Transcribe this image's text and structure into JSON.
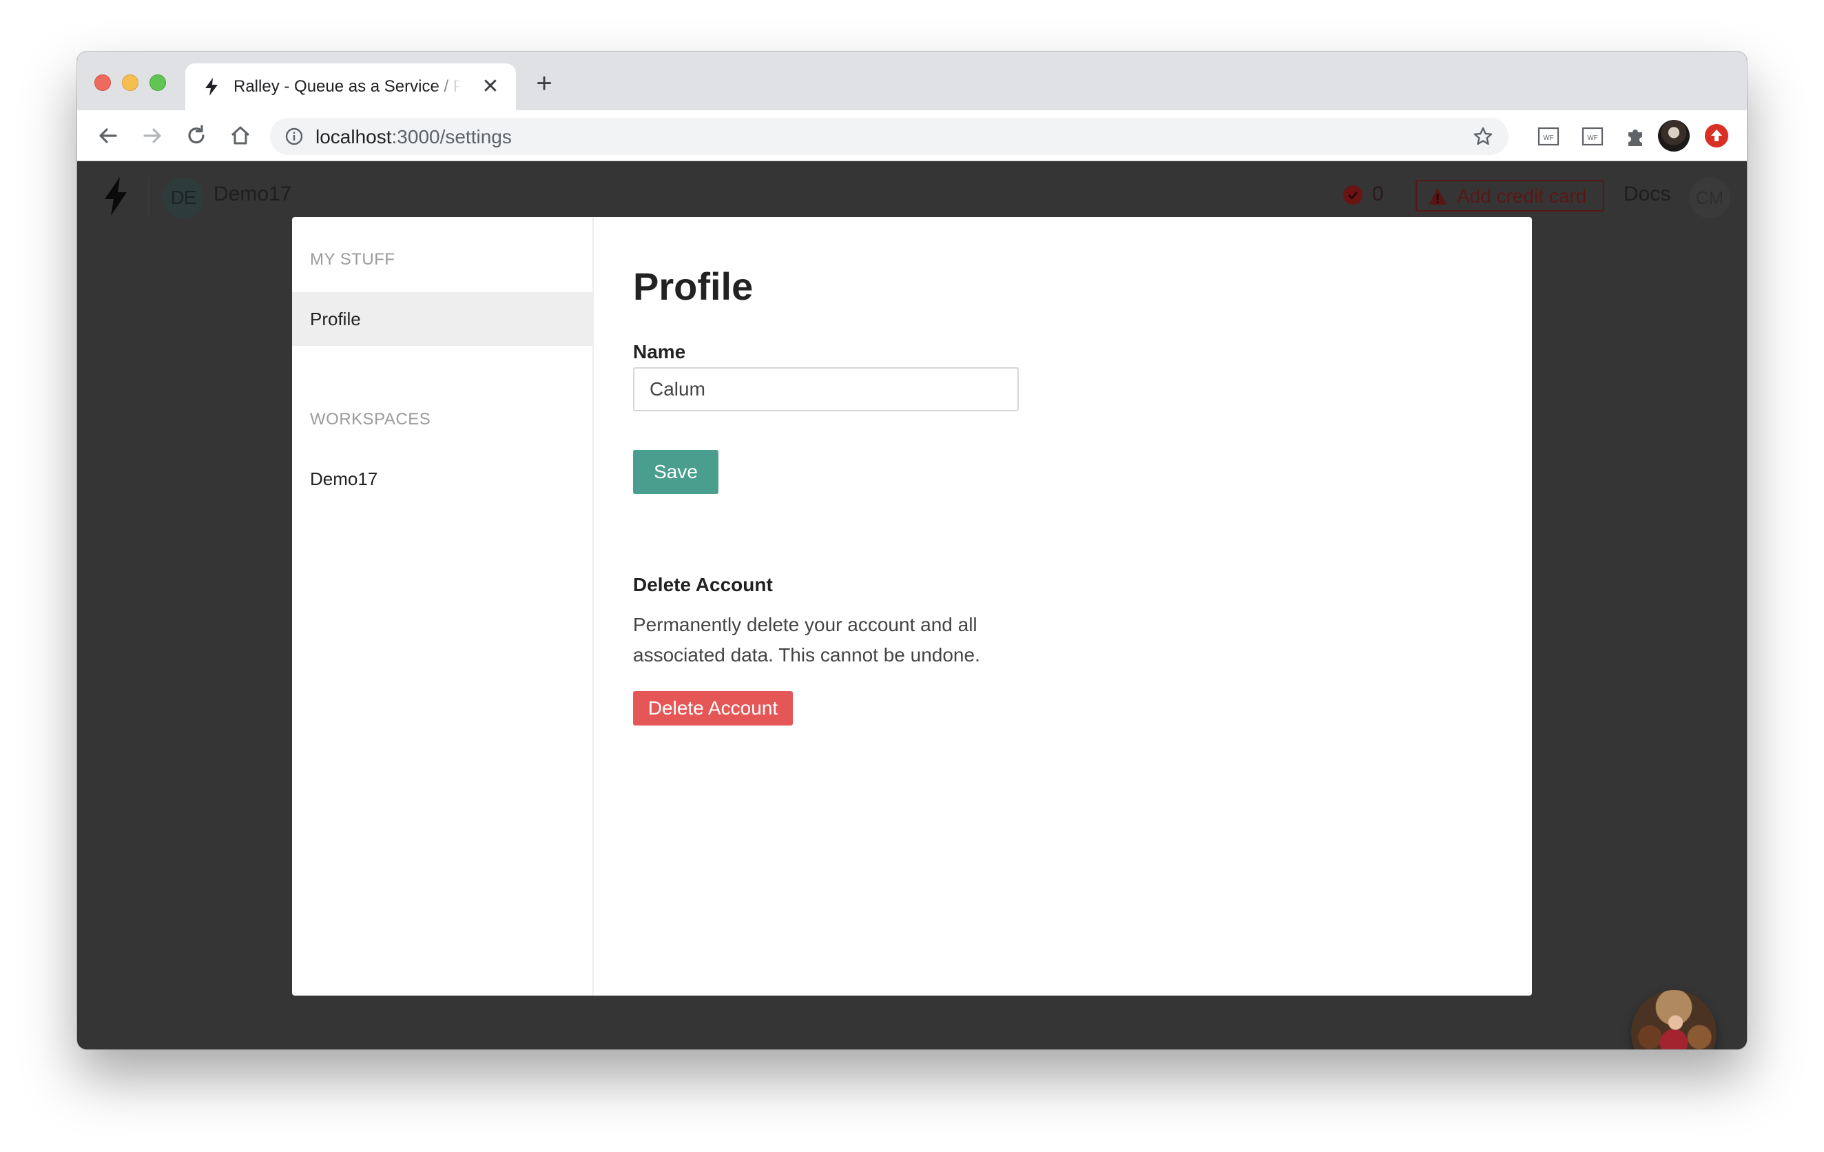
{
  "browser": {
    "tab_title": "Ralley - Queue as a Service / P",
    "tab_close": "✕",
    "new_tab": "+",
    "url_host": "localhost",
    "url_path": ":3000/settings",
    "extension_label": "WF"
  },
  "header": {
    "workspace_initials": "DE",
    "workspace_name": "Demo17",
    "error_count": "0",
    "add_credit_card_label": "Add credit card",
    "docs_label": "Docs",
    "user_initials": "CM"
  },
  "sidebar": {
    "my_stuff_heading": "MY STUFF",
    "profile_label": "Profile",
    "workspaces_heading": "WORKSPACES",
    "workspace_item_label": "Demo17"
  },
  "profile": {
    "title": "Profile",
    "name_label": "Name",
    "name_value": "Calum",
    "save_label": "Save",
    "delete_title": "Delete Account",
    "delete_description": "Permanently delete your account and all associated data. This cannot be undone.",
    "delete_button_label": "Delete Account"
  },
  "colors": {
    "save_button": "#4a9e8e",
    "delete_button": "#e55757",
    "overlay_background": "#353535"
  }
}
